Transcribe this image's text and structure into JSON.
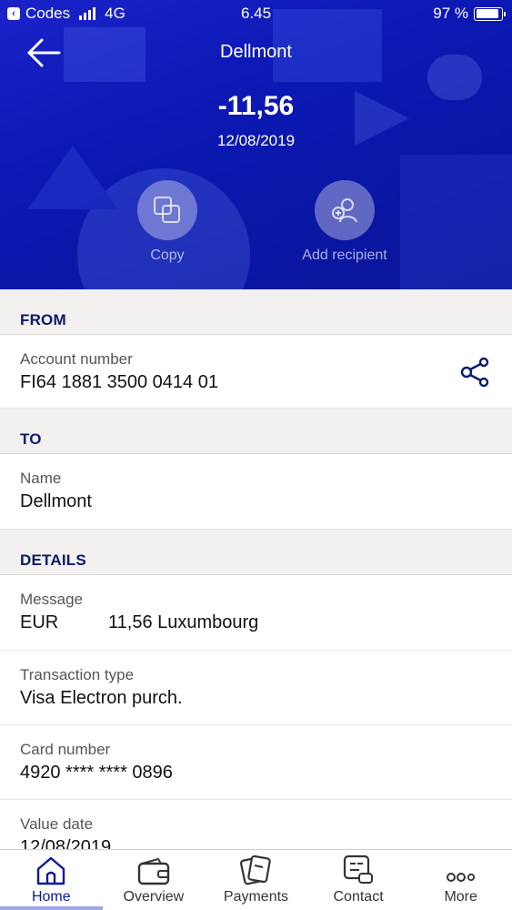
{
  "status_bar": {
    "carrier": "Codes",
    "network": "4G",
    "time": "6.45",
    "battery": "97 %"
  },
  "header": {
    "title": "Dellmont",
    "amount": "-11,56",
    "date": "12/08/2019",
    "actions": [
      {
        "label": "Copy",
        "icon": "copy-icon"
      },
      {
        "label": "Add recipient",
        "icon": "add-person-icon"
      }
    ]
  },
  "from": {
    "section_title": "FROM",
    "account_label": "Account number",
    "account_value": "FI64 1881 3500 0414 01"
  },
  "to": {
    "section_title": "TO",
    "name_label": "Name",
    "name_value": "Dellmont"
  },
  "details": {
    "section_title": "DETAILS",
    "message_label": "Message",
    "message_currency": "EUR",
    "message_text": "11,56 Luxumbourg",
    "transaction_type_label": "Transaction type",
    "transaction_type_value": "Visa Electron purch.",
    "card_number_label": "Card number",
    "card_number_value": "4920 **** **** 0896",
    "value_date_label": "Value date",
    "value_date_value": "12/08/2019"
  },
  "nav": {
    "items": [
      {
        "label": "Home",
        "icon": "home-icon",
        "active": true
      },
      {
        "label": "Overview",
        "icon": "wallet-icon"
      },
      {
        "label": "Payments",
        "icon": "payments-icon"
      },
      {
        "label": "Contact",
        "icon": "contact-icon"
      },
      {
        "label": "More",
        "icon": "more-icon"
      }
    ]
  },
  "colors": {
    "header_bg": "#1a23c9",
    "section_title": "#0a1a6b",
    "nav_active": "#0a1a9a"
  }
}
